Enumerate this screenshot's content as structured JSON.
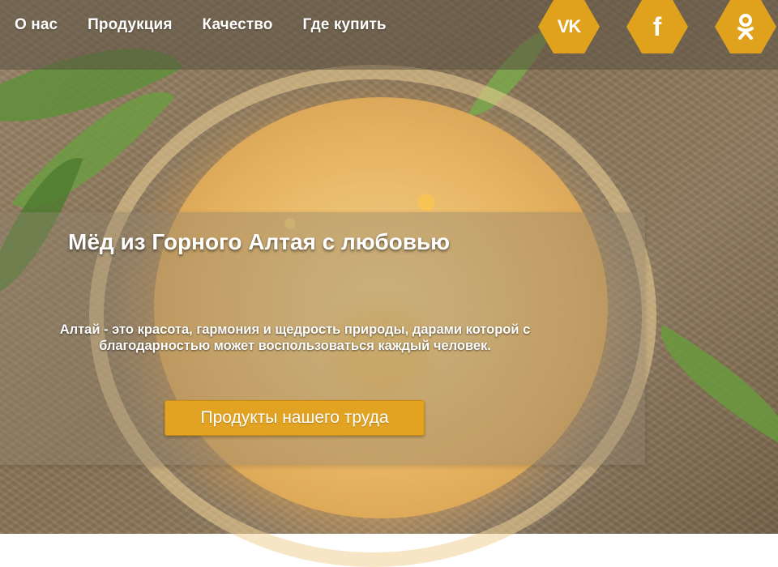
{
  "nav": {
    "items": [
      {
        "label": "О нас"
      },
      {
        "label": "Продукция"
      },
      {
        "label": "Качество"
      },
      {
        "label": "Где купить"
      }
    ]
  },
  "social": {
    "vk": {
      "label": "VK",
      "icon": "vk-icon"
    },
    "facebook": {
      "label": "f",
      "icon": "facebook-icon"
    },
    "odnoklassniki": {
      "icon": "odnoklassniki-icon"
    },
    "color": "#e0a21c"
  },
  "hero": {
    "title": "Мёд из Горного Алтая с любовью",
    "text": "Алтай - это красота, гармония и щедрость природы, дарами которой с благодарностью может воспользоваться каждый человек.",
    "cta_label": "Продукты нашего труда",
    "cta_color": "#e2a323"
  }
}
